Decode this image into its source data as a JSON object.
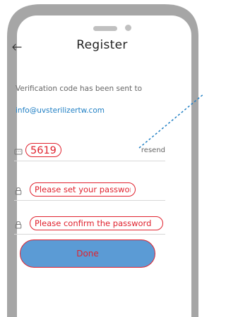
{
  "header": {
    "back_icon": "arrow-left-icon",
    "title": "Register"
  },
  "notice": {
    "text": "Verification code has been sent to",
    "email": "info@uvsterilizertw.com"
  },
  "code_field": {
    "icon": "sms-icon",
    "value": "5619",
    "resend_label": "resend"
  },
  "password_field": {
    "icon": "lock-icon",
    "placeholder": "Please set your password"
  },
  "confirm_field": {
    "icon": "lock-icon",
    "placeholder": "Please confirm the password"
  },
  "done_button": {
    "label": "Done"
  },
  "colors": {
    "accent_red": "#e0222e",
    "button_blue": "#5b9bd5",
    "link_blue": "#1f7fc4",
    "frame_gray": "#a6a6a6"
  }
}
